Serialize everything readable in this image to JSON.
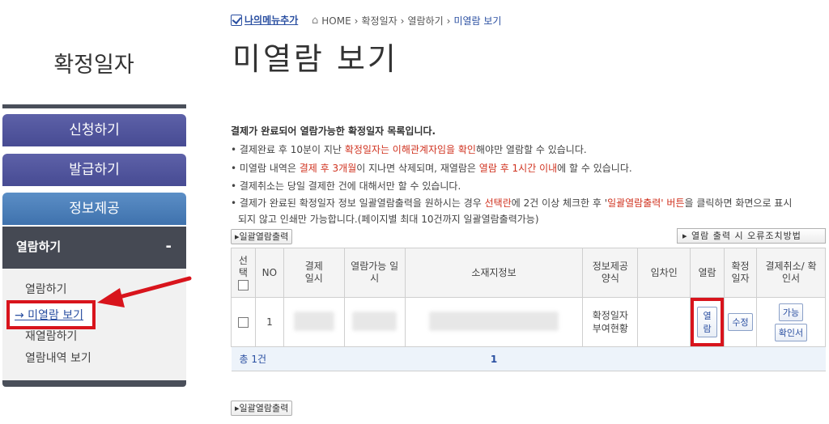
{
  "sidebar": {
    "title": "확정일자",
    "nav": {
      "apply": "신청하기",
      "issue": "발급하기",
      "info": "정보제공",
      "view": "열람하기",
      "view_toggle": "-"
    },
    "sub_items": [
      "열람하기",
      "→ 미열람 보기",
      "재열람하기",
      "열람내역 보기"
    ]
  },
  "breadcrumb": {
    "mymenu": "나의메뉴추가",
    "home": "HOME",
    "sep": "›",
    "items": [
      "확정일자",
      "열람하기",
      "미열람 보기"
    ]
  },
  "page_title": "미열람 보기",
  "notes": {
    "heading": "결제가 완료되어 열람가능한 확정일자 목록입니다.",
    "n1a": "• 결제완료 후 10분이 지난 ",
    "n1b": "확정일자는 이해관계자임을 확인",
    "n1c": "해야만 열람할 수 있습니다.",
    "n2a": "• 미열람 내역은 ",
    "n2b": "결제 후 3개월",
    "n2c": "이 지나면 삭제되며, 재열람은 ",
    "n2d": "열람 후 1시간 이내",
    "n2e": "에 할 수 있습니다.",
    "n3": "• 결제취소는 당일 결제한 건에 대해서만 할 수 있습니다.",
    "n4a": "• 결제가 완료된 확정일자 정보 일괄열람출력을 원하시는 경우 ",
    "n4b": "선택란",
    "n4c": "에 2건 이상 체크한 후 '",
    "n4d": "일괄열람출력' 버튼",
    "n4e": "을 클릭하면 화면으로 표시",
    "n5": "되지 않고 인쇄만 가능합니다.(페이지별 최대 10건까지 일괄열람출력가능)"
  },
  "buttons": {
    "batch_print": "▸일괄열람출력",
    "error_help": "▸ 열람 출력 시 오류조치방법"
  },
  "table": {
    "headers": {
      "select": "선택",
      "no": "NO",
      "pay_date": "결제 일시",
      "view_date": "열람가능 일시",
      "address": "소재지정보",
      "format": "정보제공 양식",
      "tenant": "임차인",
      "view": "열람",
      "edit": "확정 일자",
      "cancel": "결제취소/ 확인서"
    },
    "rows": [
      {
        "no": "1",
        "format": "확정일자 부여현황",
        "view_btn": "열람",
        "edit_btn": "수정",
        "available_btn": "가능",
        "confirm_btn": "확인서"
      }
    ],
    "total": "총 1건",
    "page": "1"
  },
  "colors": {
    "nav_purple": "#474b93",
    "nav_blue": "#3f72ad",
    "nav_dark": "#454953",
    "accent_red": "#d8141c",
    "link_blue": "#2a4fa1"
  }
}
